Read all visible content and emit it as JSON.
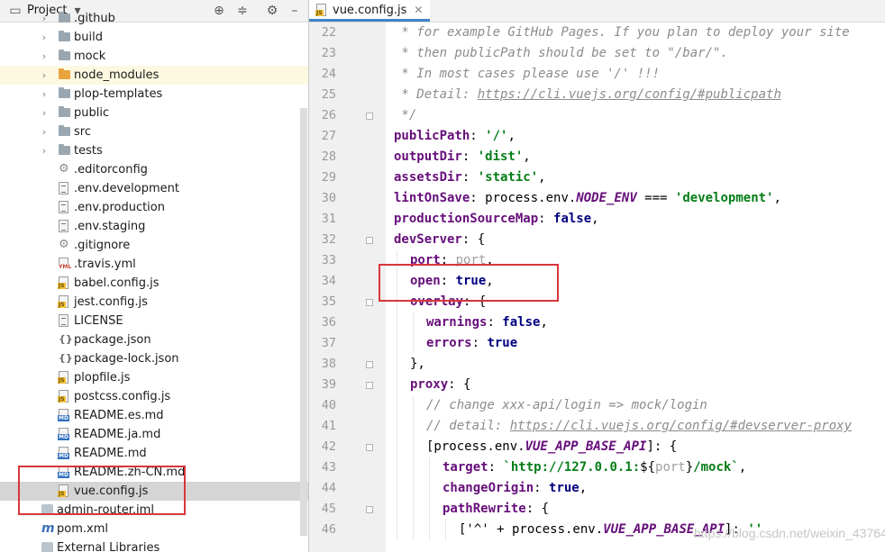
{
  "project_panel": {
    "title": "Project",
    "header_icons": [
      "crosshair-icon",
      "collapse-all-icon",
      "gear-icon",
      "minimize-icon"
    ],
    "items": [
      {
        "label": ".github",
        "kind": "folder",
        "expandable": true
      },
      {
        "label": "build",
        "kind": "folder",
        "expandable": true
      },
      {
        "label": "mock",
        "kind": "folder",
        "expandable": true
      },
      {
        "label": "node_modules",
        "kind": "folder-orange",
        "expandable": true,
        "highlight": "yellow"
      },
      {
        "label": "plop-templates",
        "kind": "folder",
        "expandable": true
      },
      {
        "label": "public",
        "kind": "folder",
        "expandable": true
      },
      {
        "label": "src",
        "kind": "folder",
        "expandable": true
      },
      {
        "label": "tests",
        "kind": "folder",
        "expandable": true
      },
      {
        "label": ".editorconfig",
        "kind": "config"
      },
      {
        "label": ".env.development",
        "kind": "text"
      },
      {
        "label": ".env.production",
        "kind": "text"
      },
      {
        "label": ".env.staging",
        "kind": "text"
      },
      {
        "label": ".gitignore",
        "kind": "config"
      },
      {
        "label": ".travis.yml",
        "kind": "yml"
      },
      {
        "label": "babel.config.js",
        "kind": "js"
      },
      {
        "label": "jest.config.js",
        "kind": "js"
      },
      {
        "label": "LICENSE",
        "kind": "text"
      },
      {
        "label": "package.json",
        "kind": "json"
      },
      {
        "label": "package-lock.json",
        "kind": "json"
      },
      {
        "label": "plopfile.js",
        "kind": "js"
      },
      {
        "label": "postcss.config.js",
        "kind": "js"
      },
      {
        "label": "README.es.md",
        "kind": "md"
      },
      {
        "label": "README.ja.md",
        "kind": "md"
      },
      {
        "label": "README.md",
        "kind": "md"
      },
      {
        "label": "README.zh-CN.md",
        "kind": "md"
      },
      {
        "label": "vue.config.js",
        "kind": "js",
        "selected": true
      },
      {
        "label": "admin-router.iml",
        "kind": "module"
      },
      {
        "label": "pom.xml",
        "kind": "maven"
      },
      {
        "label": "External Libraries",
        "kind": "library"
      }
    ]
  },
  "editor": {
    "active_tab": "vue.config.js",
    "tab_badge": "JS",
    "lines": [
      {
        "n": "22",
        "indent": 0,
        "fold": false,
        "tokens": [
          {
            "t": " * for example GitHub Pages. If you plan to deploy your site",
            "c": "comment"
          }
        ]
      },
      {
        "n": "23",
        "indent": 0,
        "fold": false,
        "tokens": [
          {
            "t": " * then publicPath should be set to \"/bar/\".",
            "c": "comment"
          }
        ]
      },
      {
        "n": "24",
        "indent": 0,
        "fold": false,
        "tokens": [
          {
            "t": " * In most cases please use '/' !!!",
            "c": "comment"
          }
        ]
      },
      {
        "n": "25",
        "indent": 0,
        "fold": false,
        "tokens": [
          {
            "t": " * Detail: ",
            "c": "comment"
          },
          {
            "t": "https://cli.vuejs.org/config/#publicpath",
            "c": "link"
          }
        ]
      },
      {
        "n": "26",
        "indent": 0,
        "fold": true,
        "tokens": [
          {
            "t": " */",
            "c": "comment"
          }
        ]
      },
      {
        "n": "27",
        "indent": 0,
        "fold": false,
        "tokens": [
          {
            "t": "publicPath",
            "c": "key"
          },
          {
            "t": ": ",
            "c": ""
          },
          {
            "t": "'/'",
            "c": "str"
          },
          {
            "t": ",",
            "c": ""
          }
        ]
      },
      {
        "n": "28",
        "indent": 0,
        "fold": false,
        "tokens": [
          {
            "t": "outputDir",
            "c": "key"
          },
          {
            "t": ": ",
            "c": ""
          },
          {
            "t": "'dist'",
            "c": "str"
          },
          {
            "t": ",",
            "c": ""
          }
        ]
      },
      {
        "n": "29",
        "indent": 0,
        "fold": false,
        "tokens": [
          {
            "t": "assetsDir",
            "c": "key"
          },
          {
            "t": ": ",
            "c": ""
          },
          {
            "t": "'static'",
            "c": "str"
          },
          {
            "t": ",",
            "c": ""
          }
        ]
      },
      {
        "n": "30",
        "indent": 0,
        "fold": false,
        "tokens": [
          {
            "t": "lintOnSave",
            "c": "key"
          },
          {
            "t": ": process.env.",
            "c": ""
          },
          {
            "t": "NODE_ENV",
            "c": "const"
          },
          {
            "t": " === ",
            "c": ""
          },
          {
            "t": "'development'",
            "c": "str"
          },
          {
            "t": ",",
            "c": ""
          }
        ]
      },
      {
        "n": "31",
        "indent": 0,
        "fold": false,
        "tokens": [
          {
            "t": "productionSourceMap",
            "c": "key"
          },
          {
            "t": ": ",
            "c": ""
          },
          {
            "t": "false",
            "c": "kw"
          },
          {
            "t": ",",
            "c": ""
          }
        ]
      },
      {
        "n": "32",
        "indent": 0,
        "fold": true,
        "tokens": [
          {
            "t": "devServer",
            "c": "key"
          },
          {
            "t": ": {",
            "c": ""
          }
        ]
      },
      {
        "n": "33",
        "indent": 1,
        "fold": false,
        "tokens": [
          {
            "t": "port",
            "c": "key"
          },
          {
            "t": ": ",
            "c": ""
          },
          {
            "t": "port",
            "c": "dim"
          },
          {
            "t": ",",
            "c": ""
          }
        ]
      },
      {
        "n": "34",
        "indent": 1,
        "fold": false,
        "tokens": [
          {
            "t": "open",
            "c": "key"
          },
          {
            "t": ": ",
            "c": ""
          },
          {
            "t": "true",
            "c": "kw"
          },
          {
            "t": ",",
            "c": ""
          }
        ]
      },
      {
        "n": "35",
        "indent": 1,
        "fold": true,
        "tokens": [
          {
            "t": "overlay",
            "c": "key"
          },
          {
            "t": ": {",
            "c": ""
          }
        ]
      },
      {
        "n": "36",
        "indent": 2,
        "fold": false,
        "tokens": [
          {
            "t": "warnings",
            "c": "key"
          },
          {
            "t": ": ",
            "c": ""
          },
          {
            "t": "false",
            "c": "kw"
          },
          {
            "t": ",",
            "c": ""
          }
        ]
      },
      {
        "n": "37",
        "indent": 2,
        "fold": false,
        "tokens": [
          {
            "t": "errors",
            "c": "key"
          },
          {
            "t": ": ",
            "c": ""
          },
          {
            "t": "true",
            "c": "kw"
          }
        ]
      },
      {
        "n": "38",
        "indent": 1,
        "fold": true,
        "tokens": [
          {
            "t": "},",
            "c": ""
          }
        ]
      },
      {
        "n": "39",
        "indent": 1,
        "fold": true,
        "tokens": [
          {
            "t": "proxy",
            "c": "key"
          },
          {
            "t": ": {",
            "c": ""
          }
        ]
      },
      {
        "n": "40",
        "indent": 2,
        "fold": false,
        "tokens": [
          {
            "t": "// change xxx-api/login => mock/login",
            "c": "comment"
          }
        ]
      },
      {
        "n": "41",
        "indent": 2,
        "fold": false,
        "tokens": [
          {
            "t": "// detail: ",
            "c": "comment"
          },
          {
            "t": "https://cli.vuejs.org/config/#devserver-proxy",
            "c": "link"
          }
        ]
      },
      {
        "n": "42",
        "indent": 2,
        "fold": true,
        "tokens": [
          {
            "t": "[process.env.",
            "c": ""
          },
          {
            "t": "VUE_APP_BASE_API",
            "c": "const"
          },
          {
            "t": "]: {",
            "c": ""
          }
        ]
      },
      {
        "n": "43",
        "indent": 3,
        "fold": false,
        "tokens": [
          {
            "t": "target",
            "c": "key"
          },
          {
            "t": ": ",
            "c": ""
          },
          {
            "t": "`http://127.0.0.1:",
            "c": "str"
          },
          {
            "t": "${",
            "c": ""
          },
          {
            "t": "port",
            "c": "dim"
          },
          {
            "t": "}",
            "c": ""
          },
          {
            "t": "/mock`",
            "c": "str"
          },
          {
            "t": ",",
            "c": ""
          }
        ]
      },
      {
        "n": "44",
        "indent": 3,
        "fold": false,
        "tokens": [
          {
            "t": "changeOrigin",
            "c": "key"
          },
          {
            "t": ": ",
            "c": ""
          },
          {
            "t": "true",
            "c": "kw"
          },
          {
            "t": ",",
            "c": ""
          }
        ]
      },
      {
        "n": "45",
        "indent": 3,
        "fold": true,
        "tokens": [
          {
            "t": "pathRewrite",
            "c": "key"
          },
          {
            "t": ": {",
            "c": ""
          }
        ]
      },
      {
        "n": "46",
        "indent": 4,
        "fold": false,
        "tokens": [
          {
            "t": "['^' + process.env.",
            "c": ""
          },
          {
            "t": "VUE_APP_BASE_API",
            "c": "const"
          },
          {
            "t": "]: ",
            "c": ""
          },
          {
            "t": "''",
            "c": "str"
          }
        ]
      }
    ]
  },
  "watermark": "https://blog.csdn.net/weixin_43764"
}
